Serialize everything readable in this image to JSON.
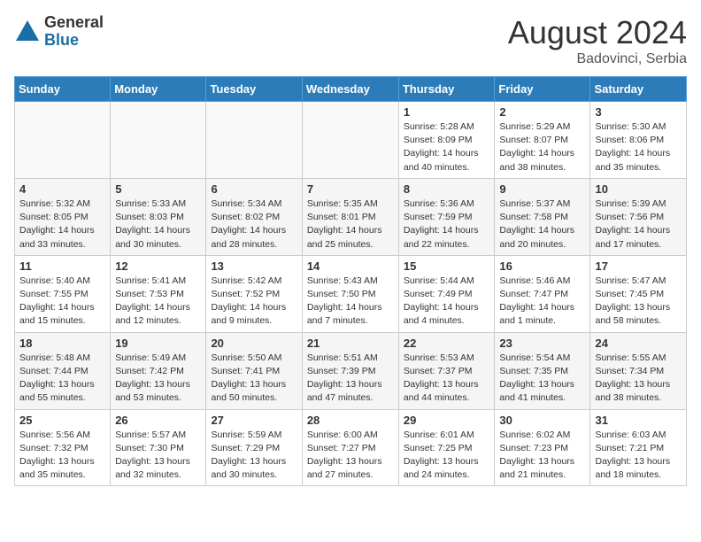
{
  "header": {
    "logo_general": "General",
    "logo_blue": "Blue",
    "month_title": "August 2024",
    "location": "Badovinci, Serbia"
  },
  "weekdays": [
    "Sunday",
    "Monday",
    "Tuesday",
    "Wednesday",
    "Thursday",
    "Friday",
    "Saturday"
  ],
  "weeks": [
    [
      {
        "day": "",
        "info": ""
      },
      {
        "day": "",
        "info": ""
      },
      {
        "day": "",
        "info": ""
      },
      {
        "day": "",
        "info": ""
      },
      {
        "day": "1",
        "info": "Sunrise: 5:28 AM\nSunset: 8:09 PM\nDaylight: 14 hours\nand 40 minutes."
      },
      {
        "day": "2",
        "info": "Sunrise: 5:29 AM\nSunset: 8:07 PM\nDaylight: 14 hours\nand 38 minutes."
      },
      {
        "day": "3",
        "info": "Sunrise: 5:30 AM\nSunset: 8:06 PM\nDaylight: 14 hours\nand 35 minutes."
      }
    ],
    [
      {
        "day": "4",
        "info": "Sunrise: 5:32 AM\nSunset: 8:05 PM\nDaylight: 14 hours\nand 33 minutes."
      },
      {
        "day": "5",
        "info": "Sunrise: 5:33 AM\nSunset: 8:03 PM\nDaylight: 14 hours\nand 30 minutes."
      },
      {
        "day": "6",
        "info": "Sunrise: 5:34 AM\nSunset: 8:02 PM\nDaylight: 14 hours\nand 28 minutes."
      },
      {
        "day": "7",
        "info": "Sunrise: 5:35 AM\nSunset: 8:01 PM\nDaylight: 14 hours\nand 25 minutes."
      },
      {
        "day": "8",
        "info": "Sunrise: 5:36 AM\nSunset: 7:59 PM\nDaylight: 14 hours\nand 22 minutes."
      },
      {
        "day": "9",
        "info": "Sunrise: 5:37 AM\nSunset: 7:58 PM\nDaylight: 14 hours\nand 20 minutes."
      },
      {
        "day": "10",
        "info": "Sunrise: 5:39 AM\nSunset: 7:56 PM\nDaylight: 14 hours\nand 17 minutes."
      }
    ],
    [
      {
        "day": "11",
        "info": "Sunrise: 5:40 AM\nSunset: 7:55 PM\nDaylight: 14 hours\nand 15 minutes."
      },
      {
        "day": "12",
        "info": "Sunrise: 5:41 AM\nSunset: 7:53 PM\nDaylight: 14 hours\nand 12 minutes."
      },
      {
        "day": "13",
        "info": "Sunrise: 5:42 AM\nSunset: 7:52 PM\nDaylight: 14 hours\nand 9 minutes."
      },
      {
        "day": "14",
        "info": "Sunrise: 5:43 AM\nSunset: 7:50 PM\nDaylight: 14 hours\nand 7 minutes."
      },
      {
        "day": "15",
        "info": "Sunrise: 5:44 AM\nSunset: 7:49 PM\nDaylight: 14 hours\nand 4 minutes."
      },
      {
        "day": "16",
        "info": "Sunrise: 5:46 AM\nSunset: 7:47 PM\nDaylight: 14 hours\nand 1 minute."
      },
      {
        "day": "17",
        "info": "Sunrise: 5:47 AM\nSunset: 7:45 PM\nDaylight: 13 hours\nand 58 minutes."
      }
    ],
    [
      {
        "day": "18",
        "info": "Sunrise: 5:48 AM\nSunset: 7:44 PM\nDaylight: 13 hours\nand 55 minutes."
      },
      {
        "day": "19",
        "info": "Sunrise: 5:49 AM\nSunset: 7:42 PM\nDaylight: 13 hours\nand 53 minutes."
      },
      {
        "day": "20",
        "info": "Sunrise: 5:50 AM\nSunset: 7:41 PM\nDaylight: 13 hours\nand 50 minutes."
      },
      {
        "day": "21",
        "info": "Sunrise: 5:51 AM\nSunset: 7:39 PM\nDaylight: 13 hours\nand 47 minutes."
      },
      {
        "day": "22",
        "info": "Sunrise: 5:53 AM\nSunset: 7:37 PM\nDaylight: 13 hours\nand 44 minutes."
      },
      {
        "day": "23",
        "info": "Sunrise: 5:54 AM\nSunset: 7:35 PM\nDaylight: 13 hours\nand 41 minutes."
      },
      {
        "day": "24",
        "info": "Sunrise: 5:55 AM\nSunset: 7:34 PM\nDaylight: 13 hours\nand 38 minutes."
      }
    ],
    [
      {
        "day": "25",
        "info": "Sunrise: 5:56 AM\nSunset: 7:32 PM\nDaylight: 13 hours\nand 35 minutes."
      },
      {
        "day": "26",
        "info": "Sunrise: 5:57 AM\nSunset: 7:30 PM\nDaylight: 13 hours\nand 32 minutes."
      },
      {
        "day": "27",
        "info": "Sunrise: 5:59 AM\nSunset: 7:29 PM\nDaylight: 13 hours\nand 30 minutes."
      },
      {
        "day": "28",
        "info": "Sunrise: 6:00 AM\nSunset: 7:27 PM\nDaylight: 13 hours\nand 27 minutes."
      },
      {
        "day": "29",
        "info": "Sunrise: 6:01 AM\nSunset: 7:25 PM\nDaylight: 13 hours\nand 24 minutes."
      },
      {
        "day": "30",
        "info": "Sunrise: 6:02 AM\nSunset: 7:23 PM\nDaylight: 13 hours\nand 21 minutes."
      },
      {
        "day": "31",
        "info": "Sunrise: 6:03 AM\nSunset: 7:21 PM\nDaylight: 13 hours\nand 18 minutes."
      }
    ]
  ]
}
